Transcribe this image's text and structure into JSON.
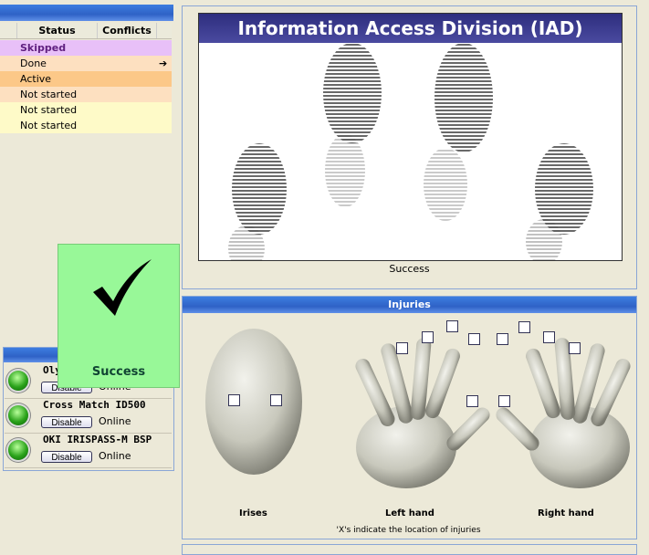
{
  "steps_table": {
    "columns": [
      "Status",
      "Conflicts"
    ],
    "rows": [
      {
        "status": "Skipped",
        "color": "#e8c0f8",
        "current": false
      },
      {
        "status": "Done",
        "color": "#fde0c0",
        "current": true
      },
      {
        "status": "Active",
        "color": "#fcc888",
        "current": false
      },
      {
        "status": "Not started",
        "color": "#fde0c0",
        "current": false
      },
      {
        "status": "Not started",
        "color": "#fefac8",
        "current": false
      },
      {
        "status": "Not started",
        "color": "#fefac8",
        "current": false
      }
    ]
  },
  "devices": [
    {
      "name": "Olympus",
      "button": "Disable",
      "status": "Online"
    },
    {
      "name": "Cross Match ID500",
      "button": "Disable",
      "status": "Online"
    },
    {
      "name": "OKI IRISPASS-M BSP",
      "button": "Disable",
      "status": "Online"
    }
  ],
  "popup": {
    "status": "Success",
    "icon": "checkmark-icon",
    "color": "#98f898"
  },
  "fingerprint": {
    "banner": "Information Access Division (IAD)",
    "status": "Success"
  },
  "injuries": {
    "title": "Injuries",
    "labels": {
      "irises": "Irises",
      "left": "Left hand",
      "right": "Right hand"
    },
    "caption": "'X's indicate the location of injuries"
  }
}
